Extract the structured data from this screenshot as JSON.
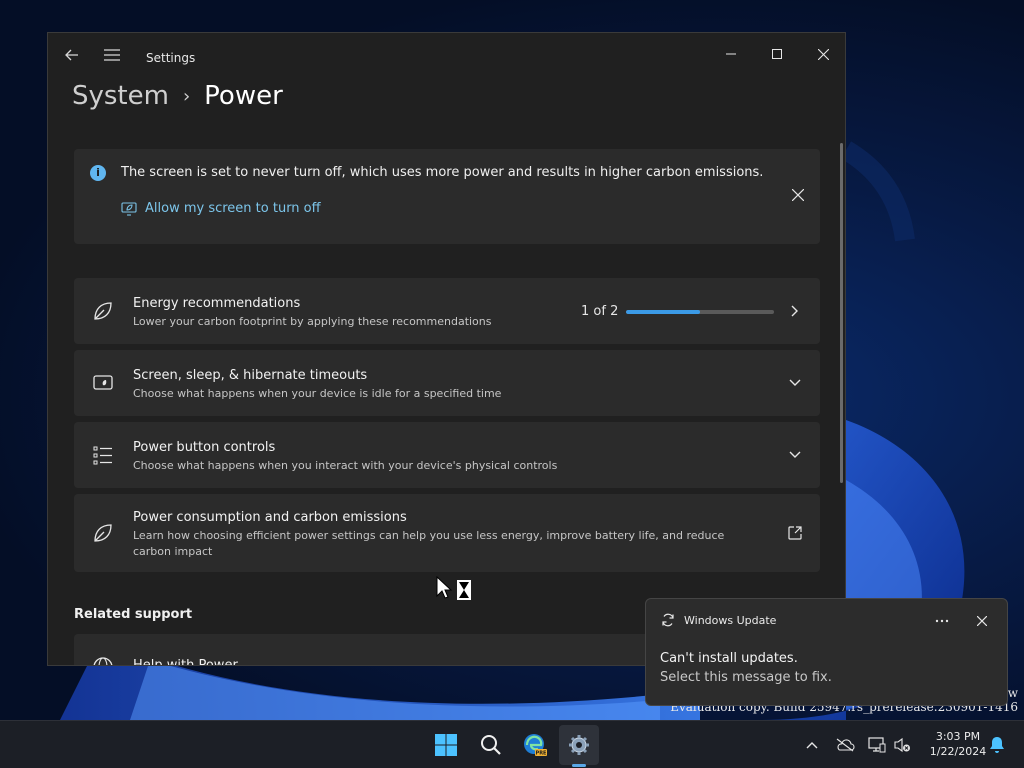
{
  "window": {
    "app_title": "Settings",
    "breadcrumb": {
      "parent": "System",
      "separator": "›",
      "current": "Power"
    }
  },
  "infobar": {
    "message": "The screen is set to never turn off, which uses more power and results in higher carbon emissions.",
    "link_label": "Allow my screen to turn off"
  },
  "cards": {
    "energy": {
      "title": "Energy recommendations",
      "subtitle": "Lower your carbon footprint by applying these recommendations",
      "progress_text": "1 of 2",
      "progress_fraction": 0.5
    },
    "sleep": {
      "title": "Screen, sleep, & hibernate timeouts",
      "subtitle": "Choose what happens when your device is idle for a specified time"
    },
    "power_button": {
      "title": "Power button controls",
      "subtitle": "Choose what happens when you interact with your device's physical controls"
    },
    "consumption": {
      "title": "Power consumption and carbon emissions",
      "subtitle": "Learn how choosing efficient power settings can help you use less energy, improve battery life, and reduce carbon impact"
    }
  },
  "related": {
    "heading": "Related support",
    "help_label": "Help with Power"
  },
  "toast": {
    "app_name": "Windows Update",
    "title": "Can't install updates.",
    "body": "Select this message to fix."
  },
  "watermark": {
    "line1": "ew",
    "line2": "Evaluation copy. Build 25947.rs_prerelease.230901-1416"
  },
  "clock": {
    "time": "3:03 PM",
    "date": "1/22/2024"
  },
  "colors": {
    "accent": "#3b9ae6",
    "link": "#7cc5ea",
    "info": "#60b6f0"
  }
}
